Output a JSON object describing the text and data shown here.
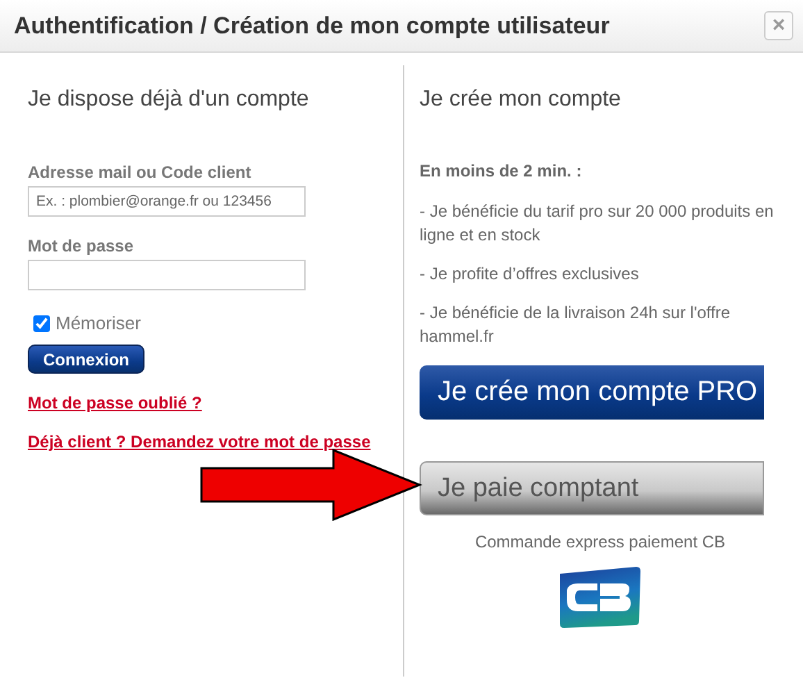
{
  "window": {
    "title": "Authentification / Création de mon compte utilisateur",
    "close": "×"
  },
  "login": {
    "heading": "Je dispose déjà d'un compte",
    "fields": [
      {
        "label": "Adresse mail ou Code client",
        "placeholder": "Ex. : plombier@orange.fr ou 123456"
      },
      {
        "label": "Mot de passe"
      }
    ],
    "remember": {
      "label": "Mémoriser",
      "checked": true
    },
    "submit": "Connexion",
    "links": [
      "Mot de passe oublié ?",
      "Déjà client ? Demandez votre mot de passe"
    ]
  },
  "register": {
    "heading": "Je crée mon compte",
    "intro": "En moins de 2 min. :",
    "benefits": [
      "- Je bénéficie du tarif pro sur 20 000 produits en ligne et en stock",
      "- Je profite d’offres exclusives",
      "- Je bénéficie de la livraison 24h sur l'offre hammel.fr"
    ],
    "pro_button": "Je crée mon compte PRO",
    "cash_button": "Je paie comptant",
    "caption": "Commande express paiement CB"
  }
}
